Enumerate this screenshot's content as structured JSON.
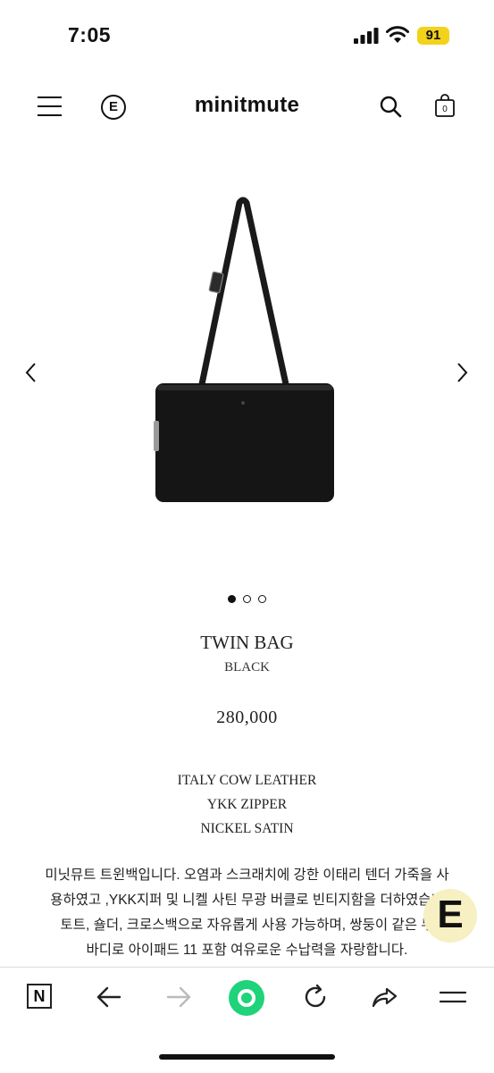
{
  "status_bar": {
    "time": "7:05",
    "battery": "91"
  },
  "header": {
    "brand": "minitmute",
    "logo_letter": "E",
    "cart_count": "0"
  },
  "product": {
    "title": "TWIN BAG",
    "color": "BLACK",
    "price": "280,000",
    "image_count": 3,
    "active_image": 1,
    "specs": [
      "ITALY COW LEATHER",
      "YKK ZIPPER",
      "NICKEL SATIN"
    ],
    "description": [
      "미닛뮤트 트윈백입니다. 오염과 스크래치에 강한 이태리 텐더 가죽을 사",
      "용하였고 ,YKK지퍼 및 니켈 사틴 무광 버클로 빈티지함을 더하였습니",
      "토트, 숄더, 크로스백으로 자유롭게 사용 가능하며, 쌍둥이 같은 두 ",
      "바디로 아이패드 11 포함 여유로운 수납력을 자랑합니다."
    ]
  },
  "floating_button": {
    "label": "E"
  },
  "bottom_nav": {
    "n_label": "N"
  },
  "colors": {
    "battery": "#f3d21c",
    "green_button": "#1ed37a",
    "fab_bg": "#f6f0c2"
  }
}
